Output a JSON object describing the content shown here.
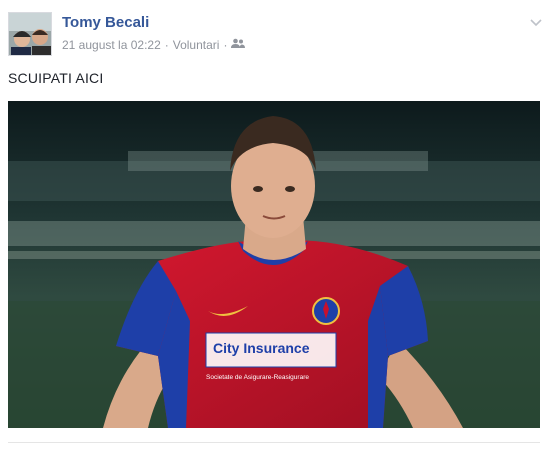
{
  "post": {
    "author_name": "Tomy Becali",
    "date": "21 august la 02:22",
    "separator": "·",
    "location": "Voluntari",
    "audience_icon": "friends-icon",
    "options_icon": "chevron-down-icon",
    "status_text": "SCUIPATI AICI"
  },
  "photo": {
    "jersey_sponsor_line1": "City Insurance",
    "jersey_sponsor_line2": "Societate de Asigurare-Reasigurare"
  },
  "colors": {
    "author_link": "#365899",
    "meta_text": "#90949c",
    "jersey_red": "#c8102e",
    "jersey_blue": "#1e3fa8"
  }
}
